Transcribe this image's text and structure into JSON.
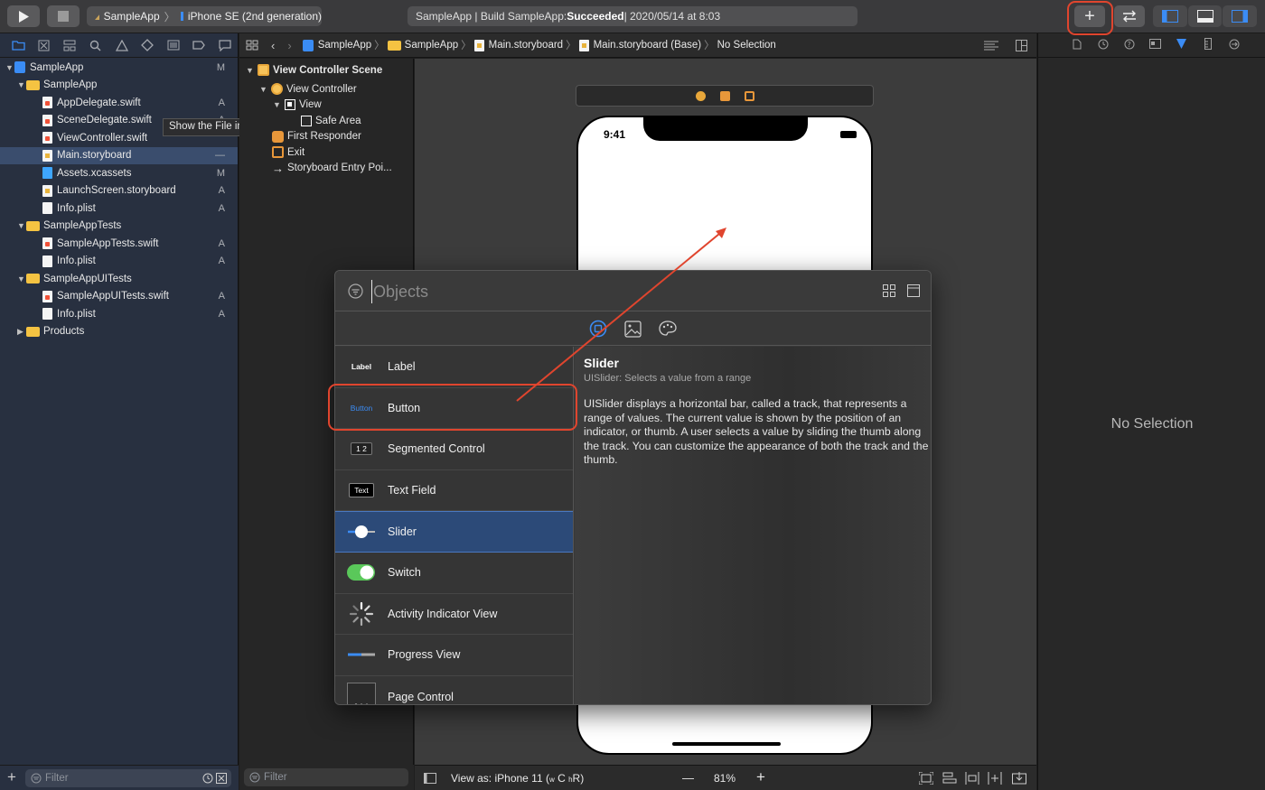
{
  "toolbar": {
    "scheme": "SampleApp",
    "device": "iPhone SE (2nd generation)",
    "activity_prefix": "SampleApp | Build SampleApp: ",
    "activity_status": "Succeeded",
    "activity_suffix": " | 2020/05/14 at 8:03",
    "library_button": "+"
  },
  "navigator": {
    "tree": [
      {
        "label": "SampleApp",
        "status": "M",
        "kind": "project"
      },
      {
        "label": "SampleApp",
        "status": "",
        "kind": "folder"
      },
      {
        "label": "AppDelegate.swift",
        "status": "A",
        "kind": "swift"
      },
      {
        "label": "SceneDelegate.swift",
        "status": "A",
        "kind": "swift"
      },
      {
        "label": "ViewController.swift",
        "status": "",
        "kind": "swift"
      },
      {
        "label": "Main.storyboard",
        "status": "—",
        "kind": "storyboard"
      },
      {
        "label": "Assets.xcassets",
        "status": "M",
        "kind": "assets"
      },
      {
        "label": "LaunchScreen.storyboard",
        "status": "A",
        "kind": "storyboard"
      },
      {
        "label": "Info.plist",
        "status": "A",
        "kind": "plist"
      },
      {
        "label": "SampleAppTests",
        "status": "",
        "kind": "folder"
      },
      {
        "label": "SampleAppTests.swift",
        "status": "A",
        "kind": "swift"
      },
      {
        "label": "Info.plist",
        "status": "A",
        "kind": "plist"
      },
      {
        "label": "SampleAppUITests",
        "status": "",
        "kind": "folder"
      },
      {
        "label": "SampleAppUITests.swift",
        "status": "A",
        "kind": "swift"
      },
      {
        "label": "Info.plist",
        "status": "A",
        "kind": "plist"
      },
      {
        "label": "Products",
        "status": "",
        "kind": "folder"
      }
    ],
    "tooltip": "Show the File inspector",
    "filter_placeholder": "Filter"
  },
  "outline": {
    "items": [
      "View Controller Scene",
      "View Controller",
      "View",
      "Safe Area",
      "First Responder",
      "Exit",
      "Storyboard Entry Poi..."
    ],
    "filter_placeholder": "Filter"
  },
  "jumpbar": {
    "crumbs": [
      "SampleApp",
      "SampleApp",
      "Main.storyboard",
      "Main.storyboard (Base)",
      "No Selection"
    ]
  },
  "canvas": {
    "phone_time": "9:41",
    "view_as": "View as: iPhone 11 (",
    "view_as_w": "w",
    "view_as_c": " C ",
    "view_as_h": "h",
    "view_as_r": "R)",
    "zoom": "81%",
    "zoom_out": "—",
    "zoom_in": "+"
  },
  "inspector": {
    "no_selection": "No Selection"
  },
  "library": {
    "search_placeholder": "Objects",
    "items": [
      {
        "thumb": "Label",
        "label": "Label"
      },
      {
        "thumb": "Button",
        "label": "Button"
      },
      {
        "thumb": "1 2",
        "label": "Segmented Control"
      },
      {
        "thumb": "Text",
        "label": "Text Field"
      },
      {
        "thumb": "",
        "label": "Slider"
      },
      {
        "thumb": "",
        "label": "Switch"
      },
      {
        "thumb": "",
        "label": "Activity Indicator View"
      },
      {
        "thumb": "",
        "label": "Progress View"
      },
      {
        "thumb": "",
        "label": "Page Control"
      }
    ],
    "detail": {
      "title": "Slider",
      "subtitle": "UISlider: Selects a value from a range",
      "description": "UISlider displays a horizontal bar, called a track, that represents a range of values. The current value is shown by the position of an indicator, or thumb. A user selects a value by sliding the thumb along the track. You can customize the appearance of both the track and the thumb."
    }
  },
  "colors": {
    "accent": "#3b8cf5",
    "annotation": "#e0452e",
    "switch_on": "#5ac85a"
  }
}
